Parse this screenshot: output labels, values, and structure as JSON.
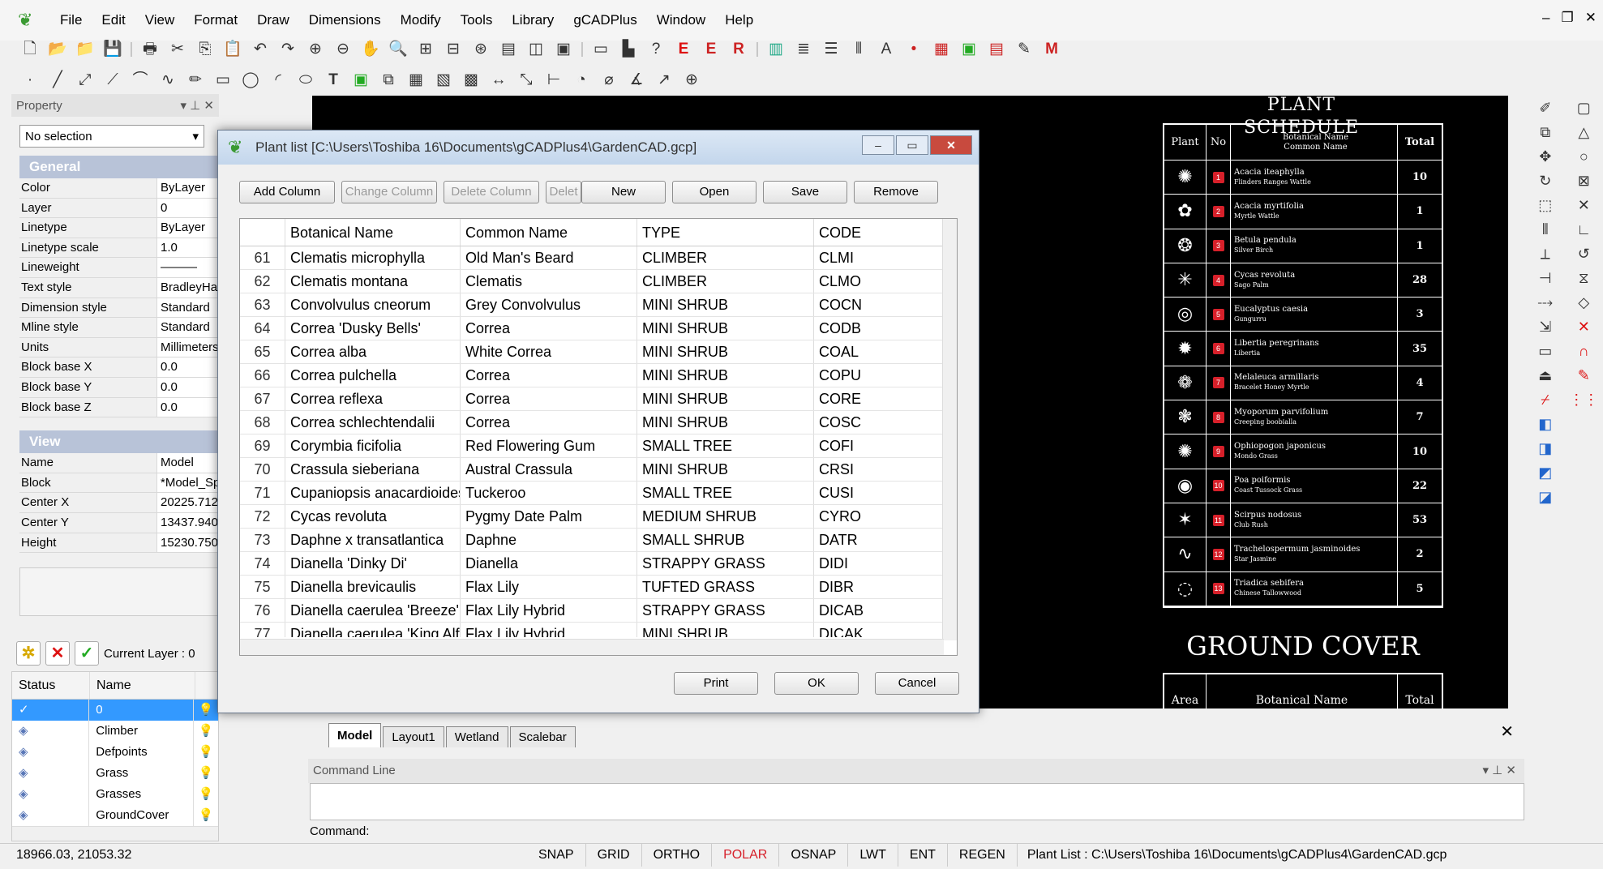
{
  "menu": [
    "File",
    "Edit",
    "View",
    "Format",
    "Draw",
    "Dimensions",
    "Modify",
    "Tools",
    "Library",
    "gCADPlus",
    "Window",
    "Help"
  ],
  "property_panel": {
    "title": "Property",
    "selection": "No selection",
    "general_header": "General",
    "general_rows": [
      {
        "key": "Color",
        "value": "ByLayer"
      },
      {
        "key": "Layer",
        "value": "0"
      },
      {
        "key": "Linetype",
        "value": "ByLayer"
      },
      {
        "key": "Linetype scale",
        "value": "1.0"
      },
      {
        "key": "Lineweight",
        "value": "———"
      },
      {
        "key": "Text style",
        "value": "BradleyHand"
      },
      {
        "key": "Dimension style",
        "value": "Standard"
      },
      {
        "key": "Mline style",
        "value": "Standard"
      },
      {
        "key": "Units",
        "value": "Millimeters"
      },
      {
        "key": "Block base X",
        "value": "0.0"
      },
      {
        "key": "Block base Y",
        "value": "0.0"
      },
      {
        "key": "Block base Z",
        "value": "0.0"
      }
    ],
    "view_header": "View",
    "view_rows": [
      {
        "key": "Name",
        "value": "Model"
      },
      {
        "key": "Block",
        "value": "*Model_Space"
      },
      {
        "key": "Center X",
        "value": "20225.712"
      },
      {
        "key": "Center Y",
        "value": "13437.940"
      },
      {
        "key": "Height",
        "value": "15230.750"
      }
    ]
  },
  "layer_panel": {
    "current_layer_label": "Current Layer : 0",
    "col_status": "Status",
    "col_name": "Name",
    "layers": [
      {
        "status": "✓",
        "name": "0",
        "selected": true
      },
      {
        "status": "◈",
        "name": "Climber",
        "selected": false
      },
      {
        "status": "◈",
        "name": "Defpoints",
        "selected": false
      },
      {
        "status": "◈",
        "name": "Grass",
        "selected": false
      },
      {
        "status": "◈",
        "name": "Grasses",
        "selected": false
      },
      {
        "status": "◈",
        "name": "GroundCover",
        "selected": false
      }
    ]
  },
  "drawing": {
    "schedule_title": "PLANT SCHEDULE",
    "headers": {
      "plant": "Plant",
      "no": "No",
      "botanical": "Botanical Name",
      "common": "Common Name",
      "total": "Total"
    },
    "rows": [
      {
        "no": "1",
        "botanical": "Acacia iteaphylla",
        "common": "Flinders Ranges Wattle",
        "total": "10",
        "sym": "✺"
      },
      {
        "no": "2",
        "botanical": "Acacia myrtifolia",
        "common": "Myrtle Wattle",
        "total": "1",
        "sym": "✿"
      },
      {
        "no": "3",
        "botanical": "Betula pendula",
        "common": "Silver Birch",
        "total": "1",
        "sym": "❂"
      },
      {
        "no": "4",
        "botanical": "Cycas revoluta",
        "common": "Sago Palm",
        "total": "28",
        "sym": "✳"
      },
      {
        "no": "5",
        "botanical": "Eucalyptus caesia",
        "common": "Gungurru",
        "total": "3",
        "sym": "◎"
      },
      {
        "no": "6",
        "botanical": "Libertia peregrinans",
        "common": "Libertia",
        "total": "35",
        "sym": "✹"
      },
      {
        "no": "7",
        "botanical": "Melaleuca armillaris",
        "common": "Bracelet Honey Myrtle",
        "total": "4",
        "sym": "❁"
      },
      {
        "no": "8",
        "botanical": "Myoporum parvifolium",
        "common": "Creeping boobialla",
        "total": "7",
        "sym": "❃"
      },
      {
        "no": "9",
        "botanical": "Ophiopogon japonicus",
        "common": "Mondo Grass",
        "total": "10",
        "sym": "✺"
      },
      {
        "no": "10",
        "botanical": "Poa poiformis",
        "common": "Coast Tussock Grass",
        "total": "22",
        "sym": "◉"
      },
      {
        "no": "11",
        "botanical": "Scirpus nodosus",
        "common": "Club Rush",
        "total": "53",
        "sym": "✶"
      },
      {
        "no": "12",
        "botanical": "Trachelospermum jasminoides",
        "common": "Star Jasmine",
        "total": "2",
        "sym": "∿"
      },
      {
        "no": "13",
        "botanical": "Triadica sebifera",
        "common": "Chinese Tallowwood",
        "total": "5",
        "sym": "◌"
      }
    ],
    "ground_cover_title": "GROUND COVER",
    "gc_headers": {
      "area": "Area",
      "botanical": "Botanical Name",
      "total": "Total"
    }
  },
  "layout_tabs": [
    "Model",
    "Layout1",
    "Wetland",
    "Scalebar"
  ],
  "command": {
    "title": "Command Line",
    "prompt": "Command:"
  },
  "status": {
    "coords": "18966.03, 21053.32",
    "buttons": [
      {
        "label": "SNAP",
        "active": false
      },
      {
        "label": "GRID",
        "active": false
      },
      {
        "label": "ORTHO",
        "active": false
      },
      {
        "label": "POLAR",
        "active": true
      },
      {
        "label": "OSNAP",
        "active": false
      },
      {
        "label": "LWT",
        "active": false
      },
      {
        "label": "ENT",
        "active": false
      },
      {
        "label": "REGEN",
        "active": false
      }
    ],
    "path": "Plant List : C:\\Users\\Toshiba 16\\Documents\\gCADPlus4\\GardenCAD.gcp"
  },
  "dialog": {
    "title": "Plant list [C:\\Users\\Toshiba 16\\Documents\\gCADPlus4\\GardenCAD.gcp]",
    "buttons": {
      "add_column": "Add Column",
      "change_column": "Change Column",
      "delete_column": "Delete Column",
      "delete": "Delet",
      "new": "New",
      "open": "Open",
      "save": "Save",
      "remove": "Remove",
      "print": "Print",
      "ok": "OK",
      "cancel": "Cancel"
    },
    "columns": [
      "Botanical Name",
      "Common Name",
      "TYPE",
      "CODE"
    ],
    "rows": [
      {
        "n": "61",
        "botanical": "Clematis microphylla",
        "common": "Old Man's Beard",
        "type": "CLIMBER",
        "code": "CLMI"
      },
      {
        "n": "62",
        "botanical": "Clematis montana",
        "common": "Clematis",
        "type": "CLIMBER",
        "code": "CLMO"
      },
      {
        "n": "63",
        "botanical": "Convolvulus cneorum",
        "common": "Grey Convolvulus",
        "type": "MINI SHRUB",
        "code": "COCN"
      },
      {
        "n": "64",
        "botanical": "Correa 'Dusky Bells'",
        "common": "Correa",
        "type": "MINI SHRUB",
        "code": "CODB"
      },
      {
        "n": "65",
        "botanical": "Correa alba",
        "common": "White Correa",
        "type": "MINI SHRUB",
        "code": "COAL"
      },
      {
        "n": "66",
        "botanical": "Correa pulchella",
        "common": "Correa",
        "type": "MINI SHRUB",
        "code": "COPU"
      },
      {
        "n": "67",
        "botanical": "Correa reflexa",
        "common": "Correa",
        "type": "MINI SHRUB",
        "code": "CORE"
      },
      {
        "n": "68",
        "botanical": "Correa schlechtendalii",
        "common": "Correa",
        "type": "MINI SHRUB",
        "code": "COSC"
      },
      {
        "n": "69",
        "botanical": "Corymbia ficifolia",
        "common": "Red Flowering Gum",
        "type": "SMALL TREE",
        "code": "COFI"
      },
      {
        "n": "70",
        "botanical": "Crassula sieberiana",
        "common": "Austral Crassula",
        "type": "MINI SHRUB",
        "code": "CRSI"
      },
      {
        "n": "71",
        "botanical": "Cupaniopsis anacardioides",
        "common": "Tuckeroo",
        "type": "SMALL TREE",
        "code": "CUSI"
      },
      {
        "n": "72",
        "botanical": "Cycas revoluta",
        "common": "Pygmy Date Palm",
        "type": "MEDIUM SHRUB",
        "code": "CYRO"
      },
      {
        "n": "73",
        "botanical": "Daphne x transatlantica",
        "common": "Daphne",
        "type": "SMALL SHRUB",
        "code": "DATR"
      },
      {
        "n": "74",
        "botanical": "Dianella 'Dinky Di'",
        "common": "Dianella",
        "type": "STRAPPY GRASS",
        "code": "DIDI"
      },
      {
        "n": "75",
        "botanical": "Dianella brevicaulis",
        "common": "Flax Lily",
        "type": "TUFTED GRASS",
        "code": "DIBR"
      },
      {
        "n": "76",
        "botanical": "Dianella caerulea 'Breeze'",
        "common": "Flax Lily Hybrid",
        "type": "STRAPPY GRASS",
        "code": "DICAB"
      },
      {
        "n": "77",
        "botanical": "Dianella caerulea 'King Alfred'",
        "common": "Flax Lily Hybrid",
        "type": "MINI SHRUB",
        "code": "DICAK"
      }
    ]
  }
}
